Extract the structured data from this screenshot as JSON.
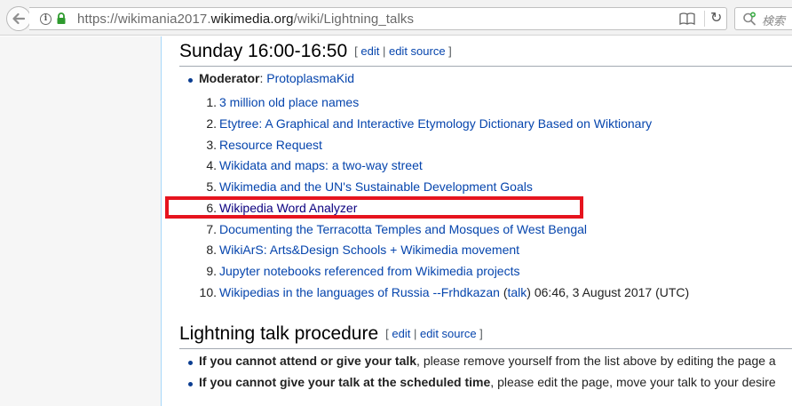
{
  "browser": {
    "url_prefix": "https://wikimania2017.",
    "url_host": "wikimedia.org",
    "url_path": "/wiki/Lightning_talks",
    "search_placeholder": "検索"
  },
  "section1": {
    "title": "Sunday 16:00-16:50",
    "edit_open": "[ ",
    "edit": "edit",
    "edit_sep": " | ",
    "edit_source": "edit source",
    "edit_close": " ]",
    "moderator_label": "Moderator",
    "moderator_colon": ": ",
    "moderator_name": "ProtoplasmaKid",
    "talks": [
      {
        "num": "1.",
        "title": "3 million old place names"
      },
      {
        "num": "2.",
        "title": "Etytree: A Graphical and Interactive Etymology Dictionary Based on Wiktionary"
      },
      {
        "num": "3.",
        "title": "Resource Request"
      },
      {
        "num": "4.",
        "title": "Wikidata and maps: a two-way street"
      },
      {
        "num": "5.",
        "title": "Wikimedia and the UN's Sustainable Development Goals"
      },
      {
        "num": "6.",
        "title": "Wikipedia Word Analyzer"
      },
      {
        "num": "7.",
        "title": "Documenting the Terracotta Temples and Mosques of West Bengal"
      },
      {
        "num": "8.",
        "title": "WikiArS: Arts&Design Schools + Wikimedia movement"
      },
      {
        "num": "9.",
        "title": "Jupyter notebooks referenced from Wikimedia projects"
      },
      {
        "num": "10.",
        "title": "Wikipedias in the languages of Russia --Frhdkazan"
      }
    ],
    "talk10_talk_open": " (",
    "talk10_talk_link": "talk",
    "talk10_talk_close": ")",
    "talk10_timestamp": " 06:46, 3 August 2017 (UTC)"
  },
  "section2": {
    "title": "Lightning talk procedure",
    "edit_open": "[ ",
    "edit": "edit",
    "edit_sep": " | ",
    "edit_source": "edit source",
    "edit_close": " ]",
    "items": [
      {
        "bold": "If you cannot attend or give your talk",
        "rest": ", please remove yourself from the list above by editing the page a"
      },
      {
        "bold": "If you cannot give your talk at the scheduled time",
        "rest": ", please edit the page, move your talk to your desire"
      }
    ]
  },
  "colors": {
    "link": "#0645ad",
    "visited_link": "#0b0080",
    "highlight": "#e6141e"
  }
}
